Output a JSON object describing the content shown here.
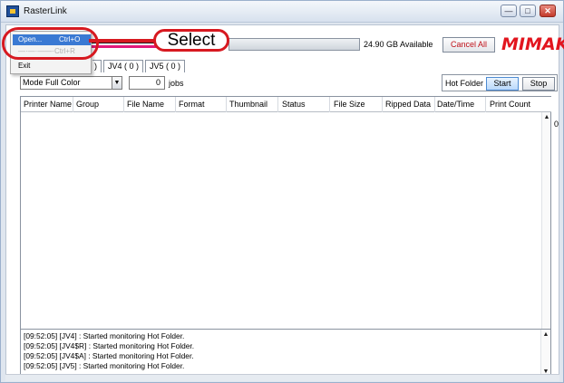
{
  "window": {
    "title": "RasterLink"
  },
  "window_controls": {
    "minimize": "—",
    "maximize": "□",
    "close": "✕"
  },
  "toolbar": {
    "storage_available": "24.90 GB Available",
    "cancel_all_label": "Cancel All",
    "brand_logo": "MIMAKI",
    "progress_fraction": 0
  },
  "printer_tabs": [
    {
      "label": ")"
    },
    {
      "label": "JV4 ( 0 )"
    },
    {
      "label": "JV5 ( 0 )"
    }
  ],
  "mode_bar": {
    "mode_label": "Mode",
    "mode_value": "Full Color",
    "jobs_count": "0",
    "jobs_label": "jobs",
    "hot_folder_label": "Hot Folder",
    "start_label": "Start",
    "stop_label": "Stop"
  },
  "job_table": {
    "columns": [
      "Printer Name",
      "Group",
      "File Name",
      "Format",
      "Thumbnail",
      "Status",
      "File Size",
      "Ripped Data",
      "Date/Time",
      "Print Count"
    ],
    "rows": []
  },
  "side_label": "0",
  "log_lines": [
    "[09:52:05] [JV4] : Started monitoring Hot Folder.",
    "[09:52:05] [JV4$R] : Started monitoring Hot Folder.",
    "[09:52:05] [JV4$A] : Started monitoring Hot Folder.",
    "[09:52:05] [JV5] : Started monitoring Hot Folder."
  ],
  "file_menu": {
    "open_label": "Open...",
    "open_shortcut": "Ctrl+O",
    "exit_label": "Exit"
  },
  "annotation": {
    "callout_text": "Select",
    "color": "#d71920"
  },
  "colors": {
    "accent_red": "#e2151e",
    "menu_highlight": "#3a79d3",
    "start_button": "#b9d8fb"
  }
}
